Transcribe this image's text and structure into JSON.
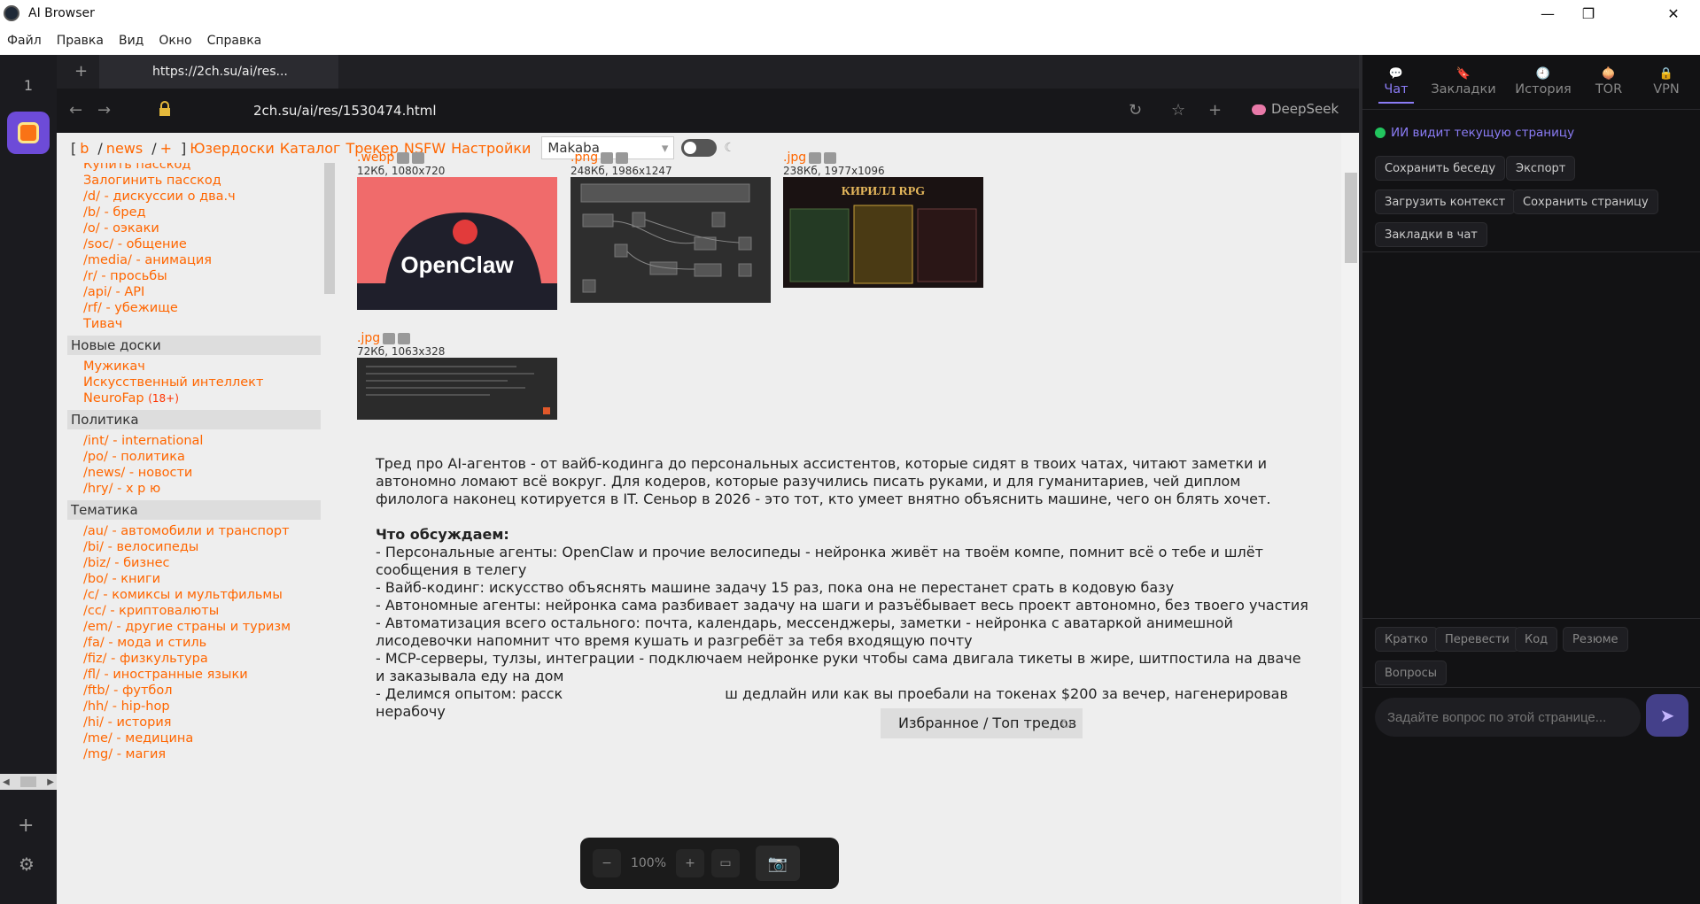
{
  "window": {
    "title": "AI Browser",
    "minimize": "—",
    "maximize": "❐",
    "close": "✕"
  },
  "menu": [
    "Файл",
    "Правка",
    "Вид",
    "Окно",
    "Справка"
  ],
  "rail": {
    "tab_number": "1",
    "add": "+",
    "settings": "⚙"
  },
  "tabs": {
    "new_tab": "+",
    "active_tab": "https://2ch.su/ai/res..."
  },
  "nav": {
    "back": "←",
    "forward": "→",
    "url": "2ch.su/ai/res/1530474.html",
    "reload": "↻",
    "bookmark": "☆",
    "add": "+",
    "ai_name": "DeepSeek"
  },
  "boardbar": {
    "open": "[",
    "b": "b",
    "slash1": "/",
    "news": "news",
    "slash2": "/",
    "plus": "+",
    "close": "]",
    "links": [
      "Юзердоски",
      "Каталог",
      "Трекер",
      "NSFW",
      "Настройки"
    ],
    "style": "Makaba"
  },
  "sidebar": {
    "top_items": [
      "Купить пасскод",
      "Залогинить пасскод",
      "/d/ - дискуссии о два.ч",
      "/b/ - бред",
      "/o/ - оэкаки",
      "/soc/ - общение",
      "/media/ - анимация",
      "/r/ - просьбы",
      "/api/ - API",
      "/rf/ - убежище",
      "Тивач"
    ],
    "new_boards_title": "Новые доски",
    "new_boards": [
      "Мужикач",
      "Искусственный интеллект",
      "NeuroFap"
    ],
    "neurofap_badge": "(18+)",
    "politics_title": "Политика",
    "politics": [
      "/int/ - international",
      "/po/ - политика",
      "/news/ - новости",
      "/hry/ - х р ю"
    ],
    "themes_title": "Тематика",
    "themes": [
      "/au/ - автомобили и транспорт",
      "/bi/ - велосипеды",
      "/biz/ - бизнес",
      "/bo/ - книги",
      "/c/ - комиксы и мультфильмы",
      "/cc/ - криптовалюты",
      "/em/ - другие страны и туризм",
      "/fa/ - мода и стиль",
      "/fiz/ - физкультура",
      "/fl/ - иностранные языки",
      "/ftb/ - футбол",
      "/hh/ - hip-hop",
      "/hi/ - история",
      "/me/ - медицина",
      "/mg/ - магия"
    ]
  },
  "images": [
    {
      "ext": ".webp",
      "meta": "12Кб, 1080x720",
      "caption": "OpenClaw"
    },
    {
      "ext": ".png",
      "meta": "248Кб, 1986x1247"
    },
    {
      "ext": ".jpg",
      "meta": "238Кб, 1977x1096",
      "caption": "КИРИЛЛ RPG"
    },
    {
      "ext": ".jpg",
      "meta": "72Кб, 1063x328"
    }
  ],
  "post": {
    "intro": "Тред про AI-агентов - от вайб-кодинга до персональных ассистентов, которые сидят в твоих чатах, читают заметки и автономно ломают всё вокруг. Для кодеров, которые разучились писать руками, и для гуманитариев, чей диплом филолога наконец котируется в IT. Сеньор в 2026 - это тот, кто умеет внятно объяснить машине, чего он блять хочет.",
    "heading": "Что обсуждаем:",
    "bullets": [
      "- Персональные агенты: OpenClaw и прочие велосипеды - нейронка живёт на твоём компе, помнит всё о тебе и шлёт сообщения в телегу",
      "- Вайб-кодинг: искусство объяснять машине задачу 15 раз, пока она не перестанет срать в кодовую базу",
      "- Автономные агенты: нейронка сама разбивает задачу на шаги и разъёбывает весь проект автономно, без твоего участия",
      "- Автоматизация всего остального: почта, календарь, мессенджеры, заметки - нейронка с аватаркой анимешной лисодевочки напомнит что время кушать и разгребёт за тебя входящую почту",
      "- MCP-серверы, тулзы, интеграции - подключаем нейронке руки чтобы сама двигала тикеты в жире, шитпостила на дваче и заказывала еду на дом",
      "- Делимся опытом: расск                                    ш дедлайн или как вы проебали на токенах $200 за вечер, нагенерировав нерабочу"
    ]
  },
  "floating": {
    "up": "⌃",
    "down": "⌄",
    "favorites": "Избранное / Топ тредов",
    "spinner": "↻"
  },
  "zoom": {
    "minus": "−",
    "value": "100%",
    "plus": "+",
    "fit": "▭",
    "camera": "📷"
  },
  "panel": {
    "tabs": [
      {
        "icon": "💬",
        "label": "Чат"
      },
      {
        "icon": "🔖",
        "label": "Закладки"
      },
      {
        "icon": "🕘",
        "label": "История"
      },
      {
        "icon": "🧅",
        "label": "TOR"
      },
      {
        "icon": "🔒",
        "label": "VPN"
      }
    ],
    "status": "ИИ видит текущую страницу",
    "actions": [
      "Сохранить беседу",
      "Экспорт",
      "Загрузить контекст",
      "Сохранить страницу",
      "Закладки в чат"
    ],
    "quick": [
      "Кратко",
      "Перевести",
      "Код",
      "Резюме",
      "Вопросы"
    ],
    "input_placeholder": "Задайте вопрос по этой странице...",
    "send": "➤"
  },
  "colors": {
    "accent": "#ff6600",
    "panel_accent": "#8b7cf6",
    "status_green": "#22c55e"
  }
}
